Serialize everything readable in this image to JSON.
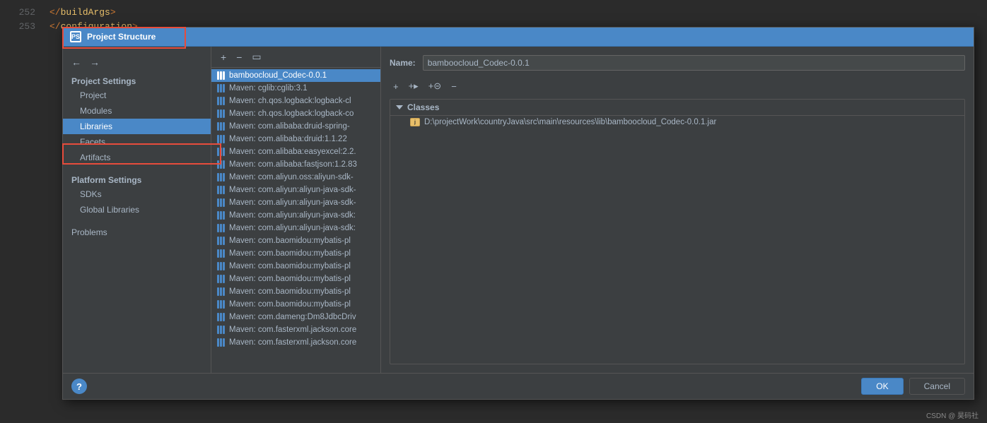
{
  "dialog": {
    "title": "Project Structure",
    "title_icon": "PS"
  },
  "bg_editor": {
    "lines": [
      {
        "num": "252",
        "content": "  </buildArgs>",
        "type": "closing-tag"
      },
      {
        "num": "253",
        "content": "  </configuration>",
        "type": "closing-tag"
      }
    ]
  },
  "left_panel": {
    "project_settings_header": "Project Settings",
    "nav_items": [
      {
        "label": "Project",
        "id": "project"
      },
      {
        "label": "Modules",
        "id": "modules"
      },
      {
        "label": "Libraries",
        "id": "libraries",
        "active": true
      },
      {
        "label": "Facets",
        "id": "facets"
      },
      {
        "label": "Artifacts",
        "id": "artifacts"
      }
    ],
    "platform_settings_header": "Platform Settings",
    "platform_items": [
      {
        "label": "SDKs",
        "id": "sdks"
      },
      {
        "label": "Global Libraries",
        "id": "global-libraries"
      }
    ],
    "problems_label": "Problems"
  },
  "middle_panel": {
    "toolbar_buttons": [
      "+",
      "−",
      "⧉"
    ],
    "libraries": [
      {
        "name": "bamboocloud_Codec-0.0.1",
        "selected": true
      },
      {
        "name": "Maven: cglib:cglib:3.1"
      },
      {
        "name": "Maven: ch.qos.logback:logback-cl"
      },
      {
        "name": "Maven: ch.qos.logback:logback-co"
      },
      {
        "name": "Maven: com.alibaba:druid-spring-"
      },
      {
        "name": "Maven: com.alibaba:druid:1.1.22"
      },
      {
        "name": "Maven: com.alibaba:easyexcel:2.2."
      },
      {
        "name": "Maven: com.alibaba:fastjson:1.2.83"
      },
      {
        "name": "Maven: com.aliyun.oss:aliyun-sdk-"
      },
      {
        "name": "Maven: com.aliyun:aliyun-java-sdk-"
      },
      {
        "name": "Maven: com.aliyun:aliyun-java-sdk-"
      },
      {
        "name": "Maven: com.aliyun:aliyun-java-sdk:"
      },
      {
        "name": "Maven: com.aliyun:aliyun-java-sdk:"
      },
      {
        "name": "Maven: com.baomidou:mybatis-pl"
      },
      {
        "name": "Maven: com.baomidou:mybatis-pl"
      },
      {
        "name": "Maven: com.baomidou:mybatis-pl"
      },
      {
        "name": "Maven: com.baomidou:mybatis-pl"
      },
      {
        "name": "Maven: com.baomidou:mybatis-pl"
      },
      {
        "name": "Maven: com.baomidou:mybatis-pl"
      },
      {
        "name": "Maven: com.dameng:Dm8JdbcDriv"
      },
      {
        "name": "Maven: com.fasterxml.jackson.core"
      },
      {
        "name": "Maven: com.fasterxml.jackson.core"
      }
    ]
  },
  "right_panel": {
    "name_label": "Name:",
    "name_value": "bamboocloud_Codec-0.0.1",
    "toolbar_buttons": [
      "+",
      "+f",
      "+c",
      "−"
    ],
    "classes_label": "Classes",
    "classes_items": [
      {
        "path": "D:\\projectWork\\countryJava\\src\\main\\resources\\lib\\bamboocloud_Codec-0.0.1.jar"
      }
    ]
  },
  "bottom": {
    "help_label": "?",
    "ok_label": "OK",
    "cancel_label": "Cancel"
  },
  "watermark": "CSDN @ 昊码社"
}
